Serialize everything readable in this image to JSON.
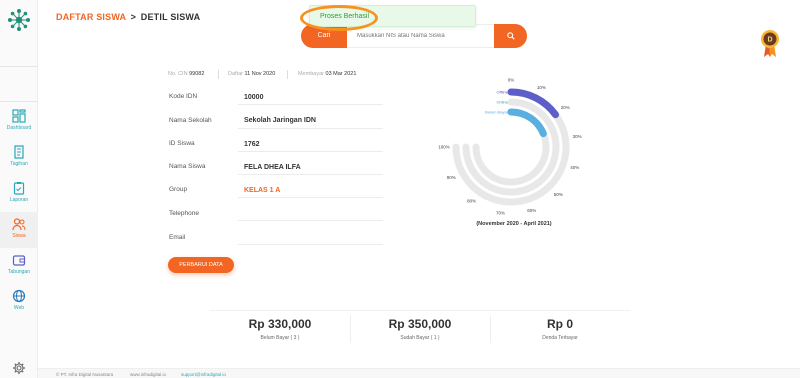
{
  "sidebar": {
    "items": [
      {
        "label": "Dashboard",
        "icon": "dashboard-icon",
        "active": false
      },
      {
        "label": "Tagihan",
        "icon": "bill-icon",
        "active": false
      },
      {
        "label": "Laporan",
        "icon": "report-icon",
        "active": false
      },
      {
        "label": "Siswa",
        "icon": "students-icon",
        "active": true
      },
      {
        "label": "Tabungan",
        "icon": "savings-icon",
        "active": false
      },
      {
        "label": "Web",
        "icon": "globe-icon",
        "active": false
      }
    ],
    "settings_icon": "gear-icon"
  },
  "header": {
    "breadcrumb_link": "DAFTAR SISWA",
    "breadcrumb_sep": ">",
    "breadcrumb_current": "DETIL SISWA"
  },
  "toast": {
    "message": "Proses Berhasil"
  },
  "search": {
    "button_label": "Cari",
    "placeholder": "Masukkan NIS atau Nama Siswa"
  },
  "medal": {
    "letter": "D"
  },
  "meta": {
    "cin_label": "No. CIN",
    "cin_value": "99082",
    "registered_label": "Daftar",
    "registered_value": "11 Nov 2020",
    "member_label": "Membayar",
    "member_value": "03 Mar 2021"
  },
  "fields": [
    {
      "label": "Kode IDN",
      "value": "10000"
    },
    {
      "label": "Nama Sekolah",
      "value": "Sekolah Jaringan IDN"
    },
    {
      "label": "ID Siswa",
      "value": "1762"
    },
    {
      "label": "Nama Siswa",
      "value": "FELA DHEA ILFA"
    },
    {
      "label": "Group",
      "value": "KELAS 1 A"
    },
    {
      "label": "Telephone",
      "value": ""
    },
    {
      "label": "Email",
      "value": ""
    }
  ],
  "update_button": "PERBARUI DATA",
  "chart_data": {
    "type": "radial-bar",
    "series": [
      {
        "name": "Offline",
        "value": 20,
        "color": "#5b5fc7"
      },
      {
        "name": "Online",
        "value": 0,
        "color": "#2aa8b8"
      },
      {
        "name": "Belum Bayar",
        "value": 25,
        "color": "#5aaee0"
      }
    ],
    "tick_labels_right": [
      "0%",
      "10%",
      "20%",
      "30%",
      "40%",
      "50%",
      "60%",
      "70%"
    ],
    "tick_labels_left": [
      "100%",
      "90%",
      "80%"
    ],
    "track_color": "#e8e8e8",
    "caption": "(November 2020 - April 2021)"
  },
  "stats": [
    {
      "value": "Rp 330,000",
      "label": "Belum Bayar ( 3 )"
    },
    {
      "value": "Rp 350,000",
      "label": "Sudah Bayar ( 1 )"
    },
    {
      "value": "Rp 0",
      "label": "Denda Terbayar"
    }
  ],
  "footer": {
    "company": "© PT. Infra Digital Nusantara",
    "website": "www.infradigital.io",
    "email": "support@infradigital.io"
  },
  "colors": {
    "accent": "#f26522",
    "teal": "#2aa8b8",
    "success_bg": "#e9f9e9",
    "ring": "#f7921e"
  }
}
